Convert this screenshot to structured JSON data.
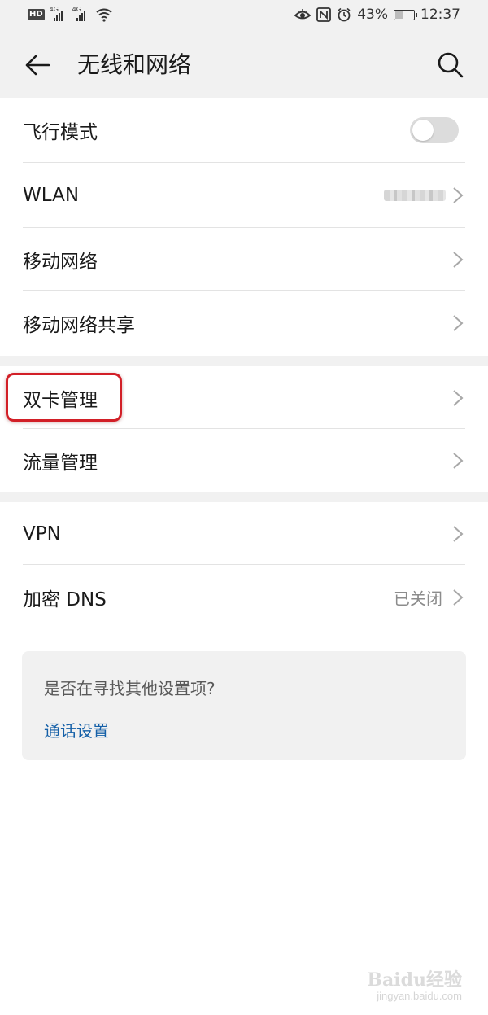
{
  "status_bar": {
    "hd_label": "HD",
    "network_type": "4G",
    "battery": "43%",
    "battery_level": 0.43,
    "time": "12:37",
    "icons": [
      "eye-care-icon",
      "nfc-icon",
      "alarm-icon",
      "battery-icon"
    ]
  },
  "header": {
    "title": "无线和网络",
    "back_icon": "back-arrow-icon",
    "search_icon": "search-icon"
  },
  "groups": [
    [
      {
        "label": "飞行模式",
        "control": "toggle",
        "on": false
      },
      {
        "label": "WLAN",
        "control": "chevron",
        "value_obscured": true
      },
      {
        "label": "移动网络",
        "control": "chevron"
      },
      {
        "label": "移动网络共享",
        "control": "chevron"
      }
    ],
    [
      {
        "label": "双卡管理",
        "control": "chevron",
        "highlighted": true
      },
      {
        "label": "流量管理",
        "control": "chevron"
      }
    ],
    [
      {
        "label": "VPN",
        "control": "chevron"
      },
      {
        "label": "加密 DNS",
        "control": "chevron",
        "value": "已关闭"
      }
    ]
  ],
  "suggestion": {
    "question": "是否在寻找其他设置项?",
    "link": "通话设置"
  },
  "watermark": {
    "brand": "Baidu经验",
    "url": "jingyan.baidu.com"
  },
  "colors": {
    "background": "#ffffff",
    "group_gap": "#f1f1f1",
    "link": "#1560a8",
    "highlight": "#d21f27",
    "secondary_text": "#8c8c8c"
  }
}
